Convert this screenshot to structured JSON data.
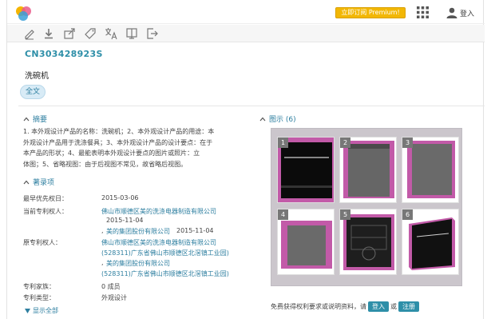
{
  "header": {
    "premium_label": "立即订阅 Premium!",
    "login_label": "登入"
  },
  "toolbar": {
    "icons": [
      "edit-icon",
      "download-icon",
      "export-icon",
      "tag-icon",
      "translate-icon",
      "book-icon",
      "share-icon"
    ]
  },
  "patent": {
    "number": "CN303428923S",
    "title": "洗碗机",
    "fulltext_label": "全文"
  },
  "abstract": {
    "heading": "摘要",
    "lines": [
      "1. 本外观设计产品的名称：洗碗机；2、本外观设计产品的用途：本",
      "外观设计产品用于洗涤餐具；3、本外观设计产品的设计要点：在于",
      "本产品的形状；4、最能表明本外观设计要点的图片或照片：立",
      "体图；5、省略视图：由于后视图不常见，故省略后视图。"
    ]
  },
  "bibliographic": {
    "heading": "著录项",
    "priority_label": "最早优先权日：",
    "priority_value": "2015-03-06",
    "assignee_label": "当前专利权人：",
    "assignee_1": "佛山市顺德区美的洗涤电器制造有限公司",
    "assignee_1_date": "2015-11-04",
    "assignee_2": "美的集团股份有限公司",
    "assignee_2_date": "2015-11-04",
    "orig_label": "原专利权人：",
    "orig_1": "佛山市顺德区美的洗涤电器制造有限公司",
    "orig_1_addr": "(528311)广东省佛山市顺德区北滘镇工业园)",
    "orig_2": "美的集团股份有限公司",
    "orig_2_addr": "(528311)广东省佛山市顺德区北滘镇工业园)",
    "family_label": "专利家族：",
    "family_value": "0 成员",
    "type_label": "专利类型：",
    "type_value": "外观设计",
    "show_all": "显示全部"
  },
  "figures": {
    "heading": "图示 (6)",
    "badges": [
      "1",
      "2",
      "3",
      "4",
      "5",
      "6"
    ]
  },
  "footer": {
    "notice": "免费获得权利要求或说明资料，请",
    "login_btn": "登入",
    "or": "或",
    "register_btn": "注册"
  },
  "colors": {
    "accent": "#2e8fa8",
    "premium": "#f2b705",
    "gallery_bg": "#cbc6cc"
  }
}
